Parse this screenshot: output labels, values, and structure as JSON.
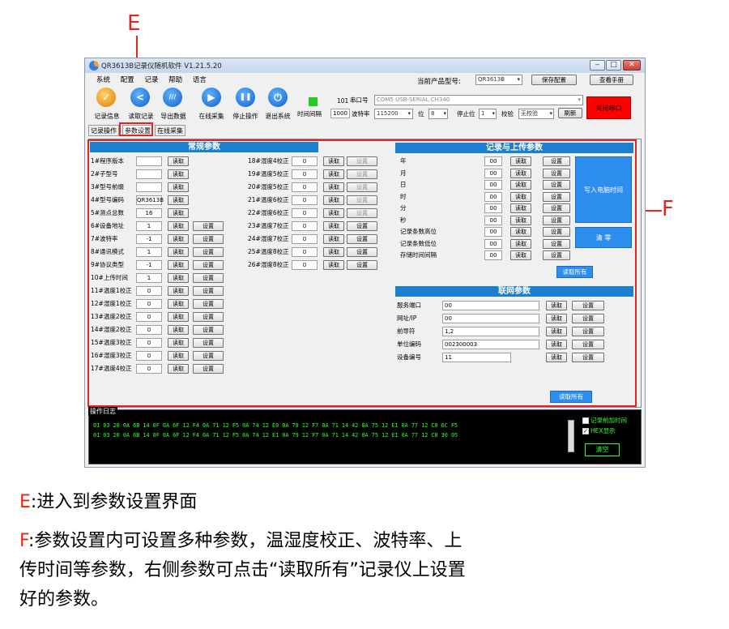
{
  "annotations": {
    "e_label": "E",
    "f_label": "F",
    "e_key": "E",
    "e_text": ":进入到参数设置界面",
    "f_key": "F",
    "f_text": ":参数设置内可设置多种参数，温湿度校正、波特率、上",
    "f_line2": "传时间等参数，右侧参数可点击“读取所有”记录仪上设置",
    "f_line3": "好的参数。"
  },
  "window": {
    "title": "QR3613B记录仪随机软件  V1.21.5.20",
    "min": "‒",
    "max": "□",
    "close": "✕"
  },
  "menu": [
    "系统",
    "配置",
    "记录",
    "帮助",
    "语言"
  ],
  "product": {
    "label": "当前产品型号:",
    "value": "QR3613B",
    "save": "保存配置",
    "manual": "查看手册"
  },
  "toolbar": [
    {
      "label": "记录信息",
      "icon": "✓"
    },
    {
      "label": "读取记录",
      "icon": "<"
    },
    {
      "label": "导出数据",
      "icon": "///"
    },
    {
      "label": "在线采集",
      "icon": "▶"
    },
    {
      "label": "停止操作",
      "icon": "❚❚"
    },
    {
      "label": "退出系统",
      "icon": "⏻"
    }
  ],
  "status": {
    "green_color": "#22cc22",
    "count": "101",
    "interval_label": "时间间隔",
    "interval_value": "1000"
  },
  "serial": {
    "port_label": "串口号",
    "port_value": "COM5 USB-SERIAL CH340",
    "baud_label": "波特率",
    "baud_value": "115200",
    "bits_label": "位",
    "bits_value": "8",
    "stop_label": "停止位",
    "stop_value": "1",
    "parity_label": "校验",
    "parity_value": "无校验",
    "refresh": "刷新",
    "close_port": "关闭串口"
  },
  "tabs": [
    "记录操作",
    "参数设置",
    "在线采集"
  ],
  "general": {
    "header": "常规参数",
    "read": "读取",
    "set": "设置",
    "left": [
      {
        "label": "1#程序版本",
        "value": "",
        "set": false
      },
      {
        "label": "2#子型号",
        "value": "",
        "set": false
      },
      {
        "label": "3#型号前缀",
        "value": "",
        "set": false
      },
      {
        "label": "4#型号编码",
        "value": "QR3613B",
        "set": false
      },
      {
        "label": "5#测点总数",
        "value": "16",
        "set": false
      },
      {
        "label": "6#设备地址",
        "value": "1",
        "set": true
      },
      {
        "label": "7#波特率",
        "value": "-1",
        "set": true
      },
      {
        "label": "8#通讯模式",
        "value": "1",
        "set": true
      },
      {
        "label": "9#协议类型",
        "value": "-1",
        "set": true
      },
      {
        "label": "10#上传时间",
        "value": "1",
        "set": true
      },
      {
        "label": "11#温度1校正",
        "value": "0",
        "set": true
      },
      {
        "label": "12#湿度1校正",
        "value": "0",
        "set": true
      },
      {
        "label": "13#温度2校正",
        "value": "0",
        "set": true
      },
      {
        "label": "14#湿度2校正",
        "value": "0",
        "set": true
      },
      {
        "label": "15#温度3校正",
        "value": "0",
        "set": true
      },
      {
        "label": "16#湿度3校正",
        "value": "0",
        "set": true
      },
      {
        "label": "17#温度4校正",
        "value": "0",
        "set": true
      }
    ],
    "right": [
      {
        "label": "18#湿度4校正",
        "value": "0",
        "enabled": false
      },
      {
        "label": "19#温度5校正",
        "value": "0",
        "enabled": false
      },
      {
        "label": "20#湿度5校正",
        "value": "0",
        "enabled": false
      },
      {
        "label": "21#温度6校正",
        "value": "0",
        "enabled": false
      },
      {
        "label": "22#湿度6校正",
        "value": "0",
        "enabled": false
      },
      {
        "label": "23#温度7校正",
        "value": "0",
        "enabled": true
      },
      {
        "label": "24#湿度7校正",
        "value": "0",
        "enabled": true
      },
      {
        "label": "25#温度8校正",
        "value": "0",
        "enabled": true
      },
      {
        "label": "26#湿度8校正",
        "value": "0",
        "enabled": true
      }
    ]
  },
  "record": {
    "header": "记录与上传参数",
    "rows": [
      {
        "label": "年",
        "value": "00"
      },
      {
        "label": "月",
        "value": "00"
      },
      {
        "label": "日",
        "value": "00"
      },
      {
        "label": "时",
        "value": "00"
      },
      {
        "label": "分",
        "value": "00"
      },
      {
        "label": "秒",
        "value": "00"
      },
      {
        "label": "记录条数高位",
        "value": "00"
      },
      {
        "label": "记录条数低位",
        "value": "00"
      },
      {
        "label": "存储时间间隔",
        "value": "00"
      }
    ],
    "write_time": "写入电脑时间",
    "clear": "清 零",
    "read_all": "读取所有"
  },
  "network": {
    "header": "联网参数",
    "rows": [
      {
        "label": "服务端口",
        "value": "00"
      },
      {
        "label": "网址/IP",
        "value": "00"
      },
      {
        "label": "前导符",
        "value": "1,2"
      },
      {
        "label": "单位编码",
        "value": "002300003"
      },
      {
        "label": "设备编号",
        "value": "11"
      }
    ],
    "read_all": "读取所有"
  },
  "log": {
    "header": "操作日志",
    "lines": [
      "01 03 20 0A 6B 14 0F 0A 6F 12 F4 0A 71 12 F5 0A 74 12 E0 0A 79 12 F7 0A 71 14 42 0A 75 12 E1 0A 77 12 C8 6C F5",
      "01 03 20 0A 6B 14 0F 0A 6F 12 F4 0A 71 12 F5 0A 74 12 E1 0A 79 12 F7 0A 71 14 42 0A 75 12 E1 0A 77 12 C8 30 05"
    ],
    "opt_time": "记录前加时间",
    "opt_hex": "HEX显示",
    "clear": "清空"
  }
}
